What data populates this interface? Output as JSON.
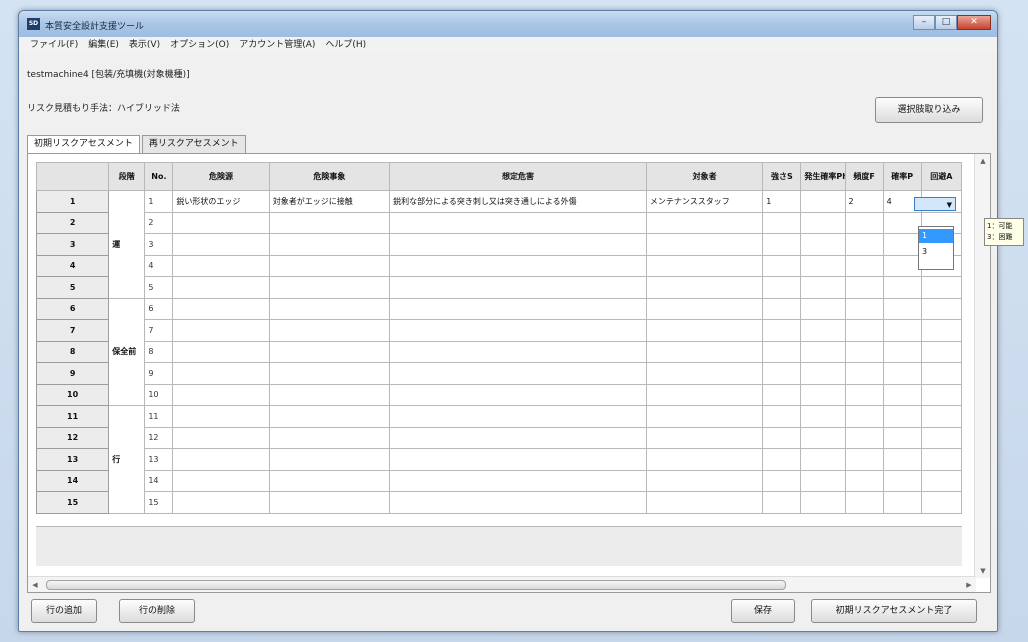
{
  "window": {
    "title": "本質安全設計支援ツール",
    "app_icon": "app-logo-icon"
  },
  "window_controls": {
    "minimize": "–",
    "maximize": "□",
    "close": "✕"
  },
  "menu": [
    "ファイル(F)",
    "編集(E)",
    "表示(V)",
    "オプション(O)",
    "アカウント管理(A)",
    "ヘルプ(H)"
  ],
  "machine_label": "testmachine4 [包装/充填機(対象機種)]",
  "method_label": "リスク見積もり手法：ハイブリッド法",
  "reload_button": "選択肢取り込み",
  "tabs": [
    "初期リスクアセスメント",
    "再リスクアセスメント"
  ],
  "columns": [
    "",
    "段階",
    "No.",
    "危険源",
    "危険事象",
    "想定危害",
    "対象者",
    "強さS",
    "発生確率Ph",
    "頻度F",
    "確率P",
    "回避A"
  ],
  "rows": [
    {
      "rowhdr": "1",
      "no": "1",
      "hazard": "鋭い形状のエッジ",
      "event": "対象者がエッジに接触",
      "harm": "鋭利な部分による突き刺し又は突き通しによる外傷",
      "target": "メンテナンススタッフ",
      "s": "1",
      "ph": "",
      "f": "2",
      "p": "4",
      "a": ""
    },
    {
      "rowhdr": "2",
      "no": "2",
      "hazard": "",
      "event": "",
      "harm": "",
      "target": "",
      "s": "",
      "ph": "",
      "f": "",
      "p": "",
      "a": ""
    },
    {
      "rowhdr": "3",
      "no": "3",
      "hazard": "",
      "event": "",
      "harm": "",
      "target": "",
      "s": "",
      "ph": "",
      "f": "",
      "p": "",
      "a": ""
    },
    {
      "rowhdr": "4",
      "no": "4",
      "hazard": "",
      "event": "",
      "harm": "",
      "target": "",
      "s": "",
      "ph": "",
      "f": "",
      "p": "",
      "a": ""
    },
    {
      "rowhdr": "5",
      "no": "5",
      "hazard": "",
      "event": "",
      "harm": "",
      "target": "",
      "s": "",
      "ph": "",
      "f": "",
      "p": "",
      "a": ""
    },
    {
      "rowhdr": "6",
      "no": "6",
      "hazard": "",
      "event": "",
      "harm": "",
      "target": "",
      "s": "",
      "ph": "",
      "f": "",
      "p": "",
      "a": ""
    },
    {
      "rowhdr": "7",
      "no": "7",
      "hazard": "",
      "event": "",
      "harm": "",
      "target": "",
      "s": "",
      "ph": "",
      "f": "",
      "p": "",
      "a": ""
    },
    {
      "rowhdr": "8",
      "no": "8",
      "hazard": "",
      "event": "",
      "harm": "",
      "target": "",
      "s": "",
      "ph": "",
      "f": "",
      "p": "",
      "a": ""
    },
    {
      "rowhdr": "9",
      "no": "9",
      "hazard": "",
      "event": "",
      "harm": "",
      "target": "",
      "s": "",
      "ph": "",
      "f": "",
      "p": "",
      "a": ""
    },
    {
      "rowhdr": "10",
      "no": "10",
      "hazard": "",
      "event": "",
      "harm": "",
      "target": "",
      "s": "",
      "ph": "",
      "f": "",
      "p": "",
      "a": ""
    },
    {
      "rowhdr": "11",
      "no": "11",
      "hazard": "",
      "event": "",
      "harm": "",
      "target": "",
      "s": "",
      "ph": "",
      "f": "",
      "p": "",
      "a": ""
    },
    {
      "rowhdr": "12",
      "no": "12",
      "hazard": "",
      "event": "",
      "harm": "",
      "target": "",
      "s": "",
      "ph": "",
      "f": "",
      "p": "",
      "a": ""
    },
    {
      "rowhdr": "13",
      "no": "13",
      "hazard": "",
      "event": "",
      "harm": "",
      "target": "",
      "s": "",
      "ph": "",
      "f": "",
      "p": "",
      "a": ""
    },
    {
      "rowhdr": "14",
      "no": "14",
      "hazard": "",
      "event": "",
      "harm": "",
      "target": "",
      "s": "",
      "ph": "",
      "f": "",
      "p": "",
      "a": ""
    },
    {
      "rowhdr": "15",
      "no": "15",
      "hazard": "",
      "event": "",
      "harm": "",
      "target": "",
      "s": "",
      "ph": "",
      "f": "",
      "p": "",
      "a": ""
    }
  ],
  "stages": [
    "運",
    "保全前",
    "行"
  ],
  "dropdown": {
    "arrow": "▼",
    "options": [
      "1",
      "3"
    ]
  },
  "tooltip": [
    "1：可能",
    "3：困難"
  ],
  "scroll": {
    "up": "▲",
    "down": "▼",
    "left": "◀",
    "right": "▶"
  },
  "buttons": {
    "add_row": "行の追加",
    "delete_row": "行の削除",
    "save": "保存",
    "complete": "初期リスクアセスメント完了"
  },
  "colors": {
    "titlebar": "#a9c5e6",
    "close": "#c7432e",
    "selection": "#3399ff"
  }
}
